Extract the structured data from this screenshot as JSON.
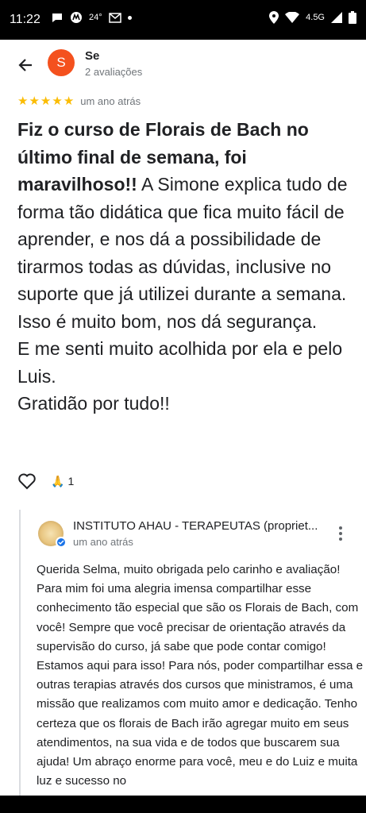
{
  "status_bar": {
    "time": "11:22",
    "temperature": "24°",
    "network": "4.5G",
    "icons": [
      "message-icon",
      "motorola-icon",
      "gmail-icon",
      "location-icon",
      "wifi-icon",
      "signal-icon",
      "battery-icon"
    ]
  },
  "header": {
    "avatar_letter": "S",
    "reviewer_name": "Se",
    "review_count": "2 avaliações",
    "avatar_color": "#f4511e"
  },
  "review": {
    "stars": 5,
    "time": "um ano atrás",
    "text_bold": "Fiz o curso de Florais de Bach no último final de semana, foi maravilhoso!!",
    "text_rest": " A Simone explica tudo de forma tão didática que fica muito fácil de aprender, e nos dá a possibilidade de tirarmos todas as dúvidas, inclusive no suporte que já utilizei durante a semana. Isso é muito bom, nos dá segurança.\nE me senti muito acolhida por ela e pelo Luis.\nGratidão por tudo!!",
    "reaction_emoji": "🙏",
    "reaction_count": "1"
  },
  "owner_reply": {
    "owner_name": "INSTITUTO AHAU - TERAPEUTAS (propriet...",
    "time": "um ano atrás",
    "text": "Querida Selma, muito obrigada pelo carinho e avaliação! Para mim foi uma alegria imensa compartilhar esse conhecimento tão especial que são os Florais de Bach, com você! Sempre que você precisar de orientação através da supervisão do curso, já sabe que pode contar comigo! Estamos aqui para isso! Para nós, poder compartilhar essa e outras terapias através dos cursos que ministramos, é uma missão que realizamos com muito amor e dedicação. Tenho certeza que os florais de Bach irão agregar muito em seus atendimentos, na sua vida e de todos que buscarem sua ajuda! Um abraço enorme para você, meu e do Luiz e muita luz e sucesso no"
  },
  "colors": {
    "star": "#fbbc04",
    "secondary_text": "#70757a",
    "verified": "#1a73e8"
  }
}
